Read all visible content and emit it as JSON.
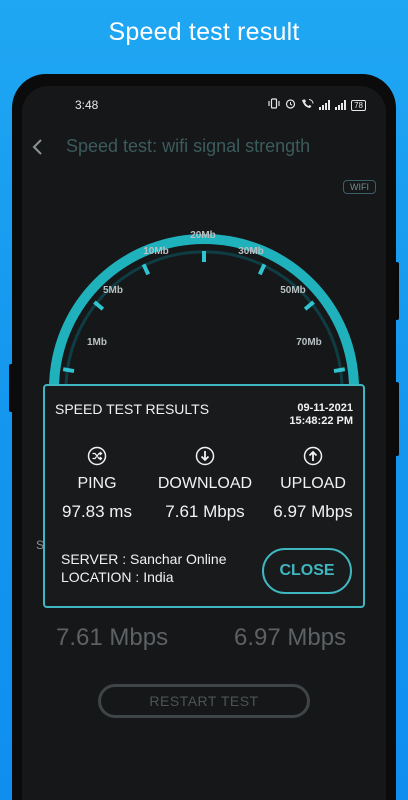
{
  "banner": {
    "title": "Speed test result"
  },
  "status_bar": {
    "time": "3:48",
    "battery": "78"
  },
  "app_bar": {
    "title": "Speed test: wifi signal strength"
  },
  "network_chip": "WIFI",
  "gauge": {
    "ticks": [
      "1Mb",
      "5Mb",
      "10Mb",
      "20Mb",
      "30Mb",
      "50Mb",
      "70Mb"
    ],
    "accent": "#1fb2bd"
  },
  "background_values": {
    "download": "7.61 Mbps",
    "upload": "6.97 Mbps"
  },
  "restart_label": "RESTART TEST",
  "peek_text": "S",
  "dialog": {
    "title": "SPEED TEST RESULTS",
    "date": "09-11-2021",
    "time": "15:48:22 PM",
    "metrics": [
      {
        "icon": "shuffle-icon",
        "label": "PING",
        "value": "97.83 ms"
      },
      {
        "icon": "download-icon",
        "label": "DOWNLOAD",
        "value": "7.61 Mbps"
      },
      {
        "icon": "upload-icon",
        "label": "UPLOAD",
        "value": "6.97 Mbps"
      }
    ],
    "server": "SERVER : Sanchar Online",
    "location": "LOCATION : India",
    "close_label": "CLOSE",
    "accent": "#3fb7c1"
  }
}
